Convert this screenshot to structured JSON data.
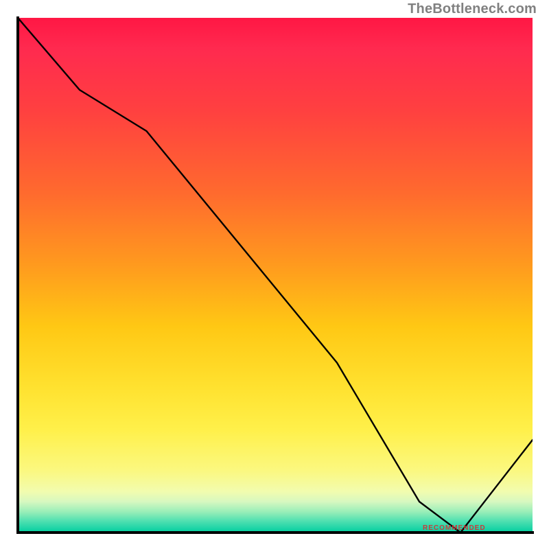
{
  "watermark": "TheBottleneck.com",
  "marker_text": "RECOMMENDED",
  "chart_data": {
    "type": "line",
    "title": "",
    "xlabel": "",
    "ylabel": "",
    "xlim": [
      0,
      100
    ],
    "ylim": [
      0,
      100
    ],
    "x": [
      0,
      12,
      25,
      62,
      78,
      86,
      100
    ],
    "values": [
      100,
      86,
      78,
      33,
      6,
      0,
      18
    ],
    "minimum_x": 84,
    "minimum_y": 0,
    "background_gradient": {
      "stops": [
        {
          "pos": 0,
          "color": "#ff1744"
        },
        {
          "pos": 50,
          "color": "#ff9a1e"
        },
        {
          "pos": 80,
          "color": "#fff04a"
        },
        {
          "pos": 95,
          "color": "#c7f6bc"
        },
        {
          "pos": 100,
          "color": "#00cf9f"
        }
      ]
    },
    "marker": {
      "x": 84,
      "text": "RECOMMENDED"
    }
  }
}
